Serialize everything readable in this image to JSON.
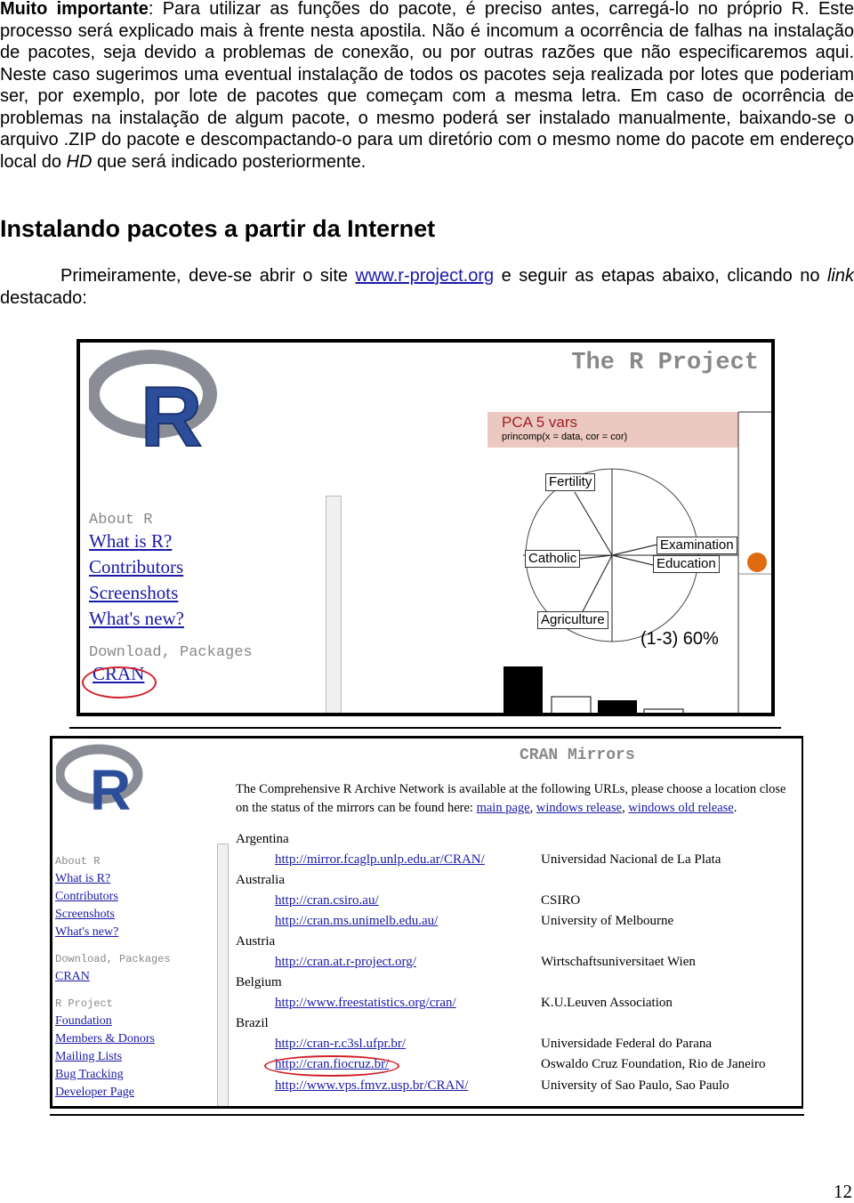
{
  "intro": {
    "bold_lead": "Muito importante",
    "text": ": Para utilizar as funções do pacote, é preciso antes, carregá-lo no próprio R. Este processo será explicado mais à frente nesta apostila. Não é incomum a ocorrência de falhas na instalação de pacotes, seja devido a problemas de conexão, ou por outras razões que não especificaremos aqui. Neste caso sugerimos uma eventual instalação de todos os pacotes seja realizada por lotes que poderiam ser, por exemplo, por lote de pacotes que começam com a mesma letra. Em caso de ocorrência de problemas na instalação de algum pacote, o mesmo poderá ser instalado manualmente, baixando-se o arquivo .ZIP do pacote e descompactando-o para um diretório com o mesmo nome do pacote em endereço local do ",
    "hd": "HD",
    "text_end": " que será indicado posteriormente."
  },
  "heading": "Instalando pacotes a partir da Internet",
  "para2": {
    "a": "Primeiramente, deve-se abrir o site ",
    "link": "www.r-project.org",
    "b": " e seguir as etapas abaixo, clicando no ",
    "italic": "link",
    "c": " destacado:"
  },
  "shot1": {
    "title": "The R Project",
    "logo": "R",
    "about_header": "About R",
    "about_links": [
      "What is R?",
      "Contributors",
      "Screenshots",
      "What's new?"
    ],
    "download_header": "Download, Packages",
    "cran_link": "CRAN",
    "pca_title": "PCA  5 vars",
    "pca_sub": "princomp(x = data, cor = cor)",
    "pca_labels": [
      "Fertility",
      "Catholic",
      "Examination",
      "Education",
      "Agriculture"
    ],
    "pca_pct": "(1-3) 60%",
    "accent": "#e06a10",
    "highlight": "#d0202a"
  },
  "shot2": {
    "title": "CRAN Mirrors",
    "logo": "R",
    "intro1": "The Comprehensive R Archive Network is available at the following URLs, please choose a location close",
    "intro2": "on the status of the mirrors can be found here: ",
    "intro_links": [
      "main page",
      "windows release",
      "windows old release"
    ],
    "nav": {
      "about_header": "About R",
      "about_links": [
        "What is R?",
        "Contributors",
        "Screenshots",
        "What's new?"
      ],
      "download_header": "Download, Packages",
      "cran": "CRAN",
      "project_header": "R Project",
      "project_links": [
        "Foundation",
        "Members & Donors",
        "Mailing Lists",
        "Bug Tracking",
        "Developer Page"
      ]
    },
    "countries": [
      "Argentina",
      "Australia",
      "Austria",
      "Belgium",
      "Brazil"
    ],
    "mirrors": [
      {
        "url": "http://mirror.fcaglp.unlp.edu.ar/CRAN/",
        "name": "Universidad Nacional de La Plata"
      },
      {
        "url": "http://cran.csiro.au/",
        "name": "CSIRO"
      },
      {
        "url": "http://cran.ms.unimelb.edu.au/",
        "name": "University of Melbourne"
      },
      {
        "url": "http://cran.at.r-project.org/",
        "name": "Wirtschaftsuniversitaet Wien"
      },
      {
        "url": "http://www.freestatistics.org/cran/",
        "name": "K.U.Leuven Association"
      },
      {
        "url": "http://cran-r.c3sl.ufpr.br/",
        "name": "Universidade Federal do Parana"
      },
      {
        "url": "http://cran.fiocruz.br/",
        "name": "Oswaldo Cruz Foundation, Rio de Janeiro"
      },
      {
        "url": "http://www.vps.fmvz.usp.br/CRAN/",
        "name": "University of Sao Paulo, Sao Paulo"
      }
    ]
  },
  "page_number": "12"
}
